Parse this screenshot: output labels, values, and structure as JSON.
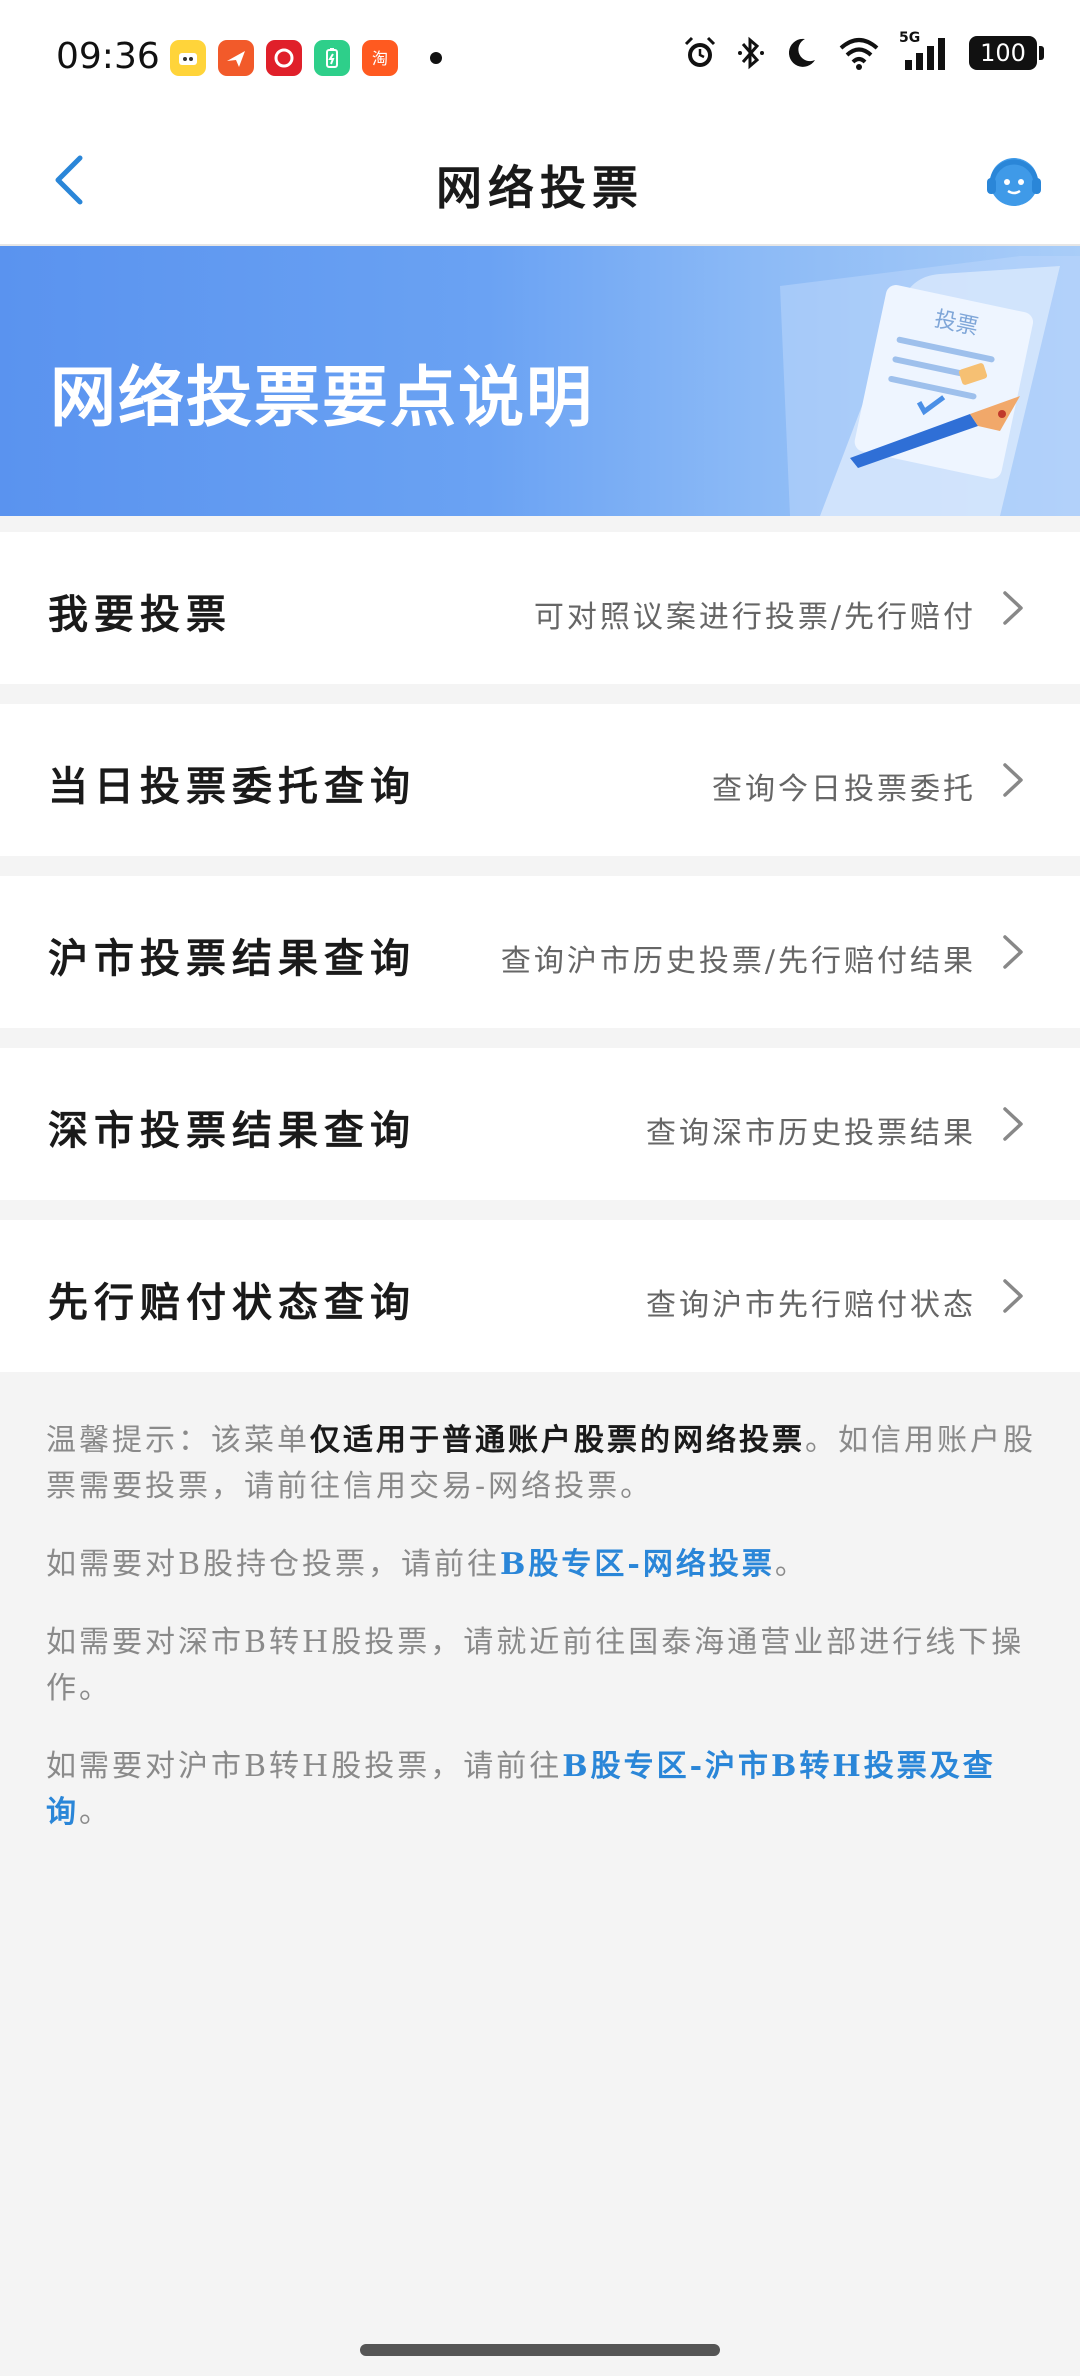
{
  "status_bar": {
    "time": "09:36",
    "network": "5G",
    "battery": "100",
    "app_icons": [
      "bilibili-like-icon",
      "plane-app-icon",
      "shopping-app-icon",
      "battery-app-icon",
      "taobao-app-icon"
    ],
    "indicator_icons": [
      "alarm-icon",
      "bluetooth-icon",
      "moon-icon",
      "wifi-icon",
      "signal-icon"
    ]
  },
  "nav": {
    "title": "网络投票",
    "back_icon": "chevron-left-icon",
    "service_icon": "customer-service-icon"
  },
  "banner": {
    "text": "网络投票要点说明",
    "art_label": "投票"
  },
  "menu": [
    {
      "title": "我要投票",
      "desc": "可对照议案进行投票/先行赔付"
    },
    {
      "title": "当日投票委托查询",
      "desc": "查询今日投票委托"
    },
    {
      "title": "沪市投票结果查询",
      "desc": "查询沪市历史投票/先行赔付结果"
    },
    {
      "title": "深市投票结果查询",
      "desc": "查询深市历史投票结果"
    },
    {
      "title": "先行赔付状态查询",
      "desc": "查询沪市先行赔付状态"
    }
  ],
  "tips": {
    "p1_prefix": "温馨提示：该菜单",
    "p1_emphasis": "仅适用于普通账户股票的网络投票",
    "p1_suffix": "。如信用账户股票需要投票，请前往信用交易-网络投票。",
    "p2_prefix": "如需要对B股持仓投票，请前往",
    "p2_link": "B股专区-网络投票",
    "p2_suffix": "。",
    "p3": "如需要对深市B转H股投票，请就近前往国泰海通营业部进行线下操作。",
    "p4_prefix": "如需要对沪市B转H股投票，请前往",
    "p4_link": "B股专区-沪市B转H投票及查询",
    "p4_suffix": "。"
  },
  "colors": {
    "accent": "#2a86d8",
    "banner_start": "#5a93ef",
    "banner_end": "#a9cdf8",
    "page_bg": "#f4f4f4"
  }
}
